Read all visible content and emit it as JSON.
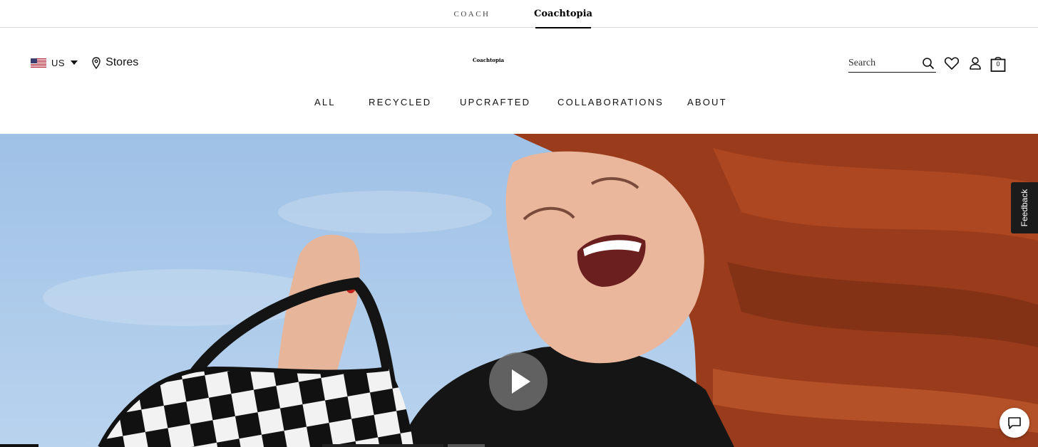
{
  "brand_switcher": {
    "coach": "COACH",
    "coachtopia": "Coachtopia",
    "active": "Coachtopia"
  },
  "header": {
    "locale": {
      "flag_icon": "us-flag-icon",
      "label": "US"
    },
    "stores": {
      "icon": "location-pin-icon",
      "label": "Stores"
    },
    "logo": "Coachtopia",
    "search": {
      "placeholder": "Search",
      "icon": "search-icon"
    },
    "wishlist_icon": "heart-icon",
    "account_icon": "account-icon",
    "bag": {
      "icon": "shopping-bag-icon",
      "count": "0"
    }
  },
  "nav": {
    "items": [
      {
        "label": "ALL"
      },
      {
        "label": "RECYCLED"
      },
      {
        "label": "UPCRAFTED"
      },
      {
        "label": "COLLABORATIONS"
      },
      {
        "label": "ABOUT"
      }
    ]
  },
  "hero": {
    "play_icon": "play-icon",
    "feedback_label": "Feedback",
    "chat_icon": "chat-icon"
  },
  "colors": {
    "sky": "#a9c8ea",
    "hair": "#9a3c1c",
    "text": "#111111",
    "feedback_bg": "#1b1b1b"
  }
}
